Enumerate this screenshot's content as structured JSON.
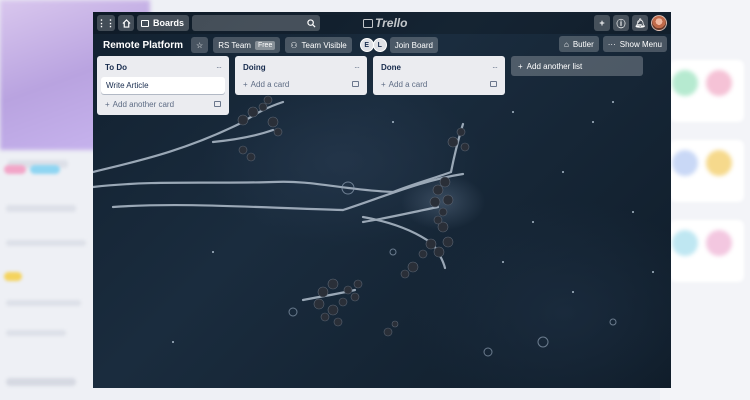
{
  "topbar": {
    "apps_icon": "grid-icon",
    "home_icon": "home-icon",
    "boards_label": "Boards",
    "search_icon": "search-icon",
    "logo_text": "Trello",
    "create_icon": "plus-icon",
    "info_icon": "info-icon",
    "notifications_icon": "bell-icon"
  },
  "board": {
    "title": "Remote Platform",
    "star_icon": "star-icon",
    "team_label": "RS Team",
    "team_badge": "Free",
    "visibility_label": "Team Visible",
    "members": [
      "E",
      "L"
    ],
    "join_label": "Join Board",
    "butler_label": "Butler",
    "menu_label": "Show Menu"
  },
  "lists": [
    {
      "title": "To Do",
      "cards": [
        "Write Article"
      ],
      "add_label": "Add another card"
    },
    {
      "title": "Doing",
      "cards": [],
      "add_label": "Add a card"
    },
    {
      "title": "Done",
      "cards": [],
      "add_label": "Add a card"
    }
  ],
  "add_list_label": "Add another list",
  "colors": {
    "board_bg": "#142535",
    "list_bg": "#ebecf0",
    "card_text": "#172b4d"
  }
}
